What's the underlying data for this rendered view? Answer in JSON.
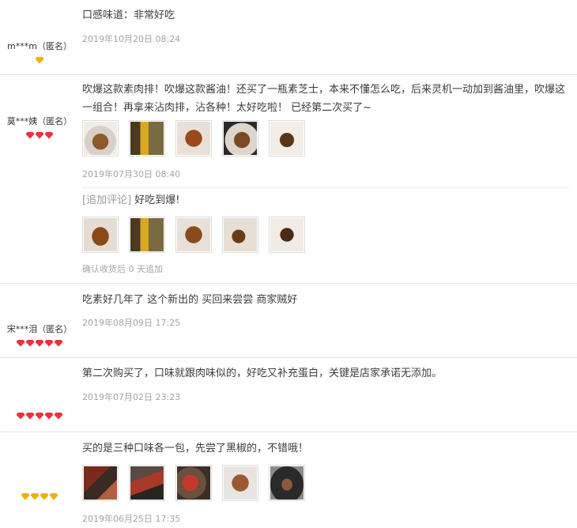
{
  "reviews": [
    {
      "user": "m***m（匿名）",
      "badge_color": "yellow",
      "badges": 1,
      "content": "口感味道：非常好吃",
      "date": "2019年10月20日 08:24"
    },
    {
      "user": "莫***姨（匿名）",
      "badge_color": "red",
      "badges": 3,
      "content": "吹爆这款素肉排！吹爆这款酱油！还买了一瓶素芝士，本来不懂怎么吃，后来灵机一动加到酱油里，吹爆这一组合！再拿来沾肉排，沾各种！太好吃啦！ 已经第二次买了~",
      "date": "2019年07月30日 08:40",
      "append_label": "[追加评论]",
      "append_text": "好吃到爆!",
      "confirm_text": "确认收货后 0 天追加"
    },
    {
      "user": "宋***泪（匿名）",
      "badge_color": "red",
      "badges": 5,
      "content": "吃素好几年了 这个新出的 买回来尝尝 商家贼好",
      "date": "2019年08月09日 17:25"
    },
    {
      "user": "",
      "badge_color": "red",
      "badges": 5,
      "content": "第二次购买了，口味就跟肉味似的，好吃又补充蛋白，关键是店家承诺无添加。",
      "date": "2019年07月02日 23:23"
    },
    {
      "user": "",
      "badge_color": "yellow",
      "badges": 4,
      "content": "买的是三种口味各一包，先尝了黑椒的，不错哦！",
      "date": "2019年06月25日 17:35"
    }
  ],
  "colors": {
    "date": "#a3a3a3",
    "badge_red": "#e8323c",
    "badge_yellow": "#f0b000",
    "divider": "#e6e6e6"
  }
}
